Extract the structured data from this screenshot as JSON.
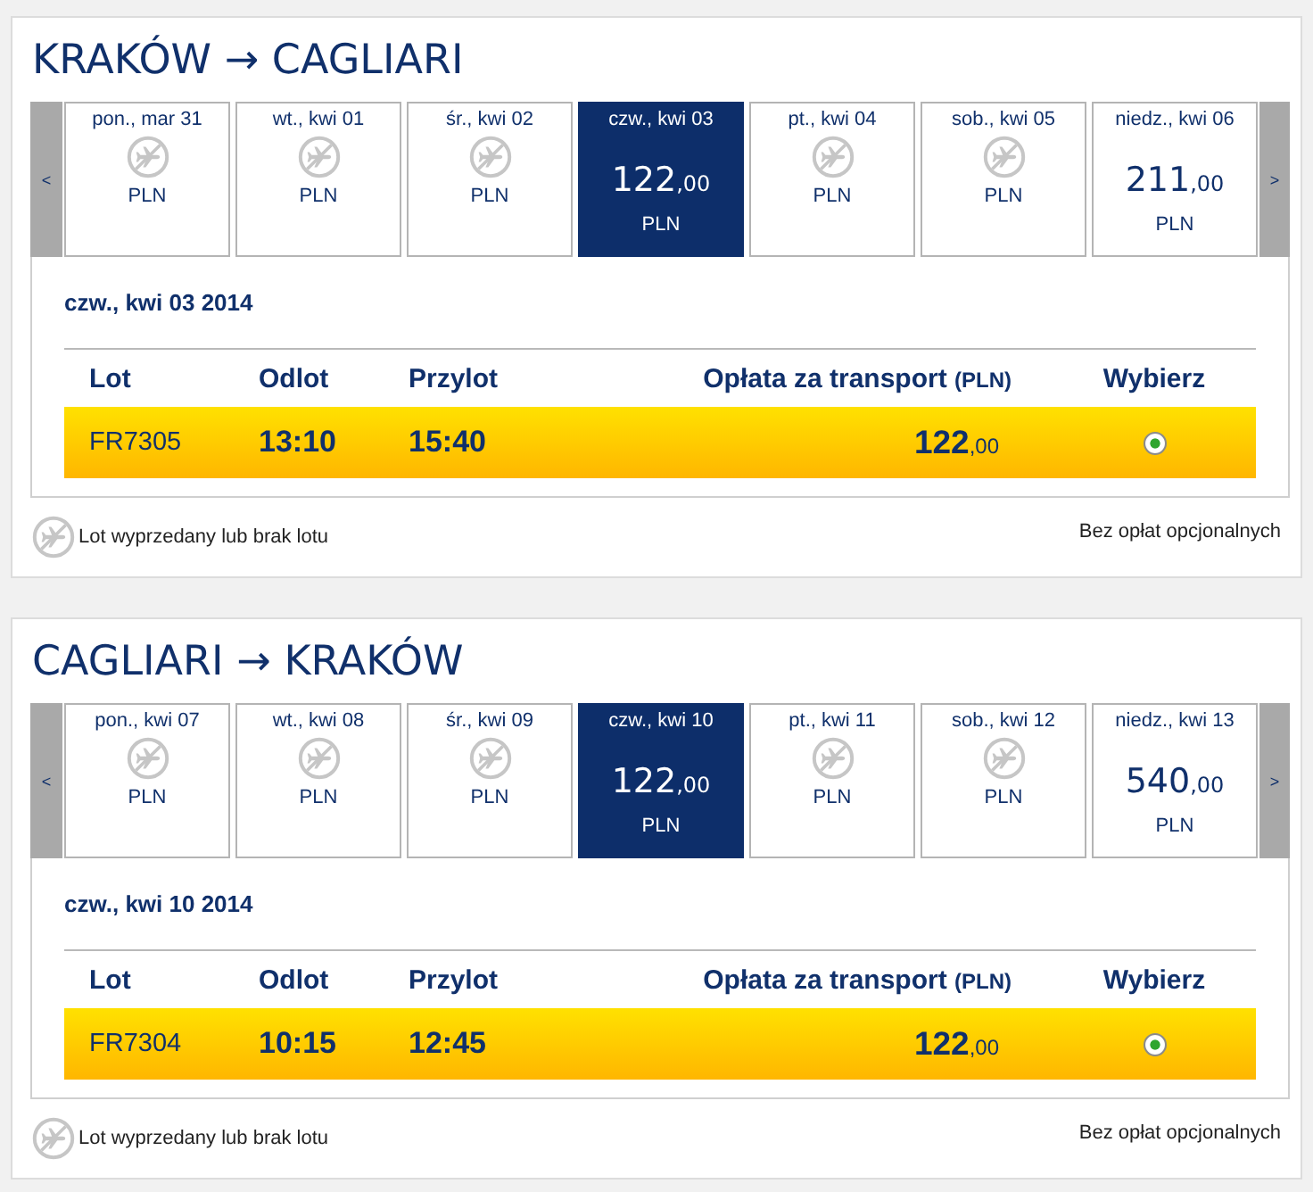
{
  "sections": [
    {
      "title": "KRAKÓW → CAGLIARI",
      "prev_button": "<",
      "next_button": ">",
      "days": [
        {
          "label": "pon., mar 31",
          "kind": "unavailable",
          "currency": "PLN",
          "selected": false
        },
        {
          "label": "wt., kwi 01",
          "kind": "unavailable",
          "currency": "PLN",
          "selected": false
        },
        {
          "label": "śr., kwi 02",
          "kind": "unavailable",
          "currency": "PLN",
          "selected": false
        },
        {
          "label": "czw., kwi 03",
          "kind": "fare",
          "price": "122",
          "price_decimals": ",00",
          "currency": "PLN",
          "selected": true
        },
        {
          "label": "pt., kwi 04",
          "kind": "unavailable",
          "currency": "PLN",
          "selected": false
        },
        {
          "label": "sob., kwi 05",
          "kind": "unavailable",
          "currency": "PLN",
          "selected": false
        },
        {
          "label": "niedz., kwi 06",
          "kind": "fare",
          "price": "211",
          "price_decimals": ",00",
          "currency": "PLN",
          "selected": false
        }
      ],
      "date_heading": "czw., kwi 03 2014",
      "table": {
        "columns": [
          {
            "label": "Lot"
          },
          {
            "label": "Odlot"
          },
          {
            "label": "Przylot"
          },
          {
            "label": "Opłata za transport",
            "unit": "(PLN)"
          },
          {
            "label": "Wybierz"
          }
        ],
        "rows": [
          {
            "flight": "FR7305",
            "departure": "13:10",
            "arrival": "15:40",
            "price": "122",
            "price_decimals": ",00",
            "selected": true
          }
        ]
      },
      "legend": "Lot wyprzedany lub brak lotu",
      "note": "Bez opłat opcjonalnych"
    },
    {
      "title": "CAGLIARI → KRAKÓW",
      "prev_button": "<",
      "next_button": ">",
      "days": [
        {
          "label": "pon., kwi 07",
          "kind": "unavailable",
          "currency": "PLN",
          "selected": false
        },
        {
          "label": "wt., kwi 08",
          "kind": "unavailable",
          "currency": "PLN",
          "selected": false
        },
        {
          "label": "śr., kwi 09",
          "kind": "unavailable",
          "currency": "PLN",
          "selected": false
        },
        {
          "label": "czw., kwi 10",
          "kind": "fare",
          "price": "122",
          "price_decimals": ",00",
          "currency": "PLN",
          "selected": true
        },
        {
          "label": "pt., kwi 11",
          "kind": "unavailable",
          "currency": "PLN",
          "selected": false
        },
        {
          "label": "sob., kwi 12",
          "kind": "unavailable",
          "currency": "PLN",
          "selected": false
        },
        {
          "label": "niedz., kwi 13",
          "kind": "fare",
          "price": "540",
          "price_decimals": ",00",
          "currency": "PLN",
          "selected": false
        }
      ],
      "date_heading": "czw., kwi 10 2014",
      "table": {
        "columns": [
          {
            "label": "Lot"
          },
          {
            "label": "Odlot"
          },
          {
            "label": "Przylot"
          },
          {
            "label": "Opłata za transport",
            "unit": "(PLN)"
          },
          {
            "label": "Wybierz"
          }
        ],
        "rows": [
          {
            "flight": "FR7304",
            "departure": "10:15",
            "arrival": "12:45",
            "price": "122",
            "price_decimals": ",00",
            "selected": true
          }
        ]
      },
      "legend": "Lot wyprzedany lub brak lotu",
      "note": "Bez opłat opcjonalnych"
    }
  ]
}
